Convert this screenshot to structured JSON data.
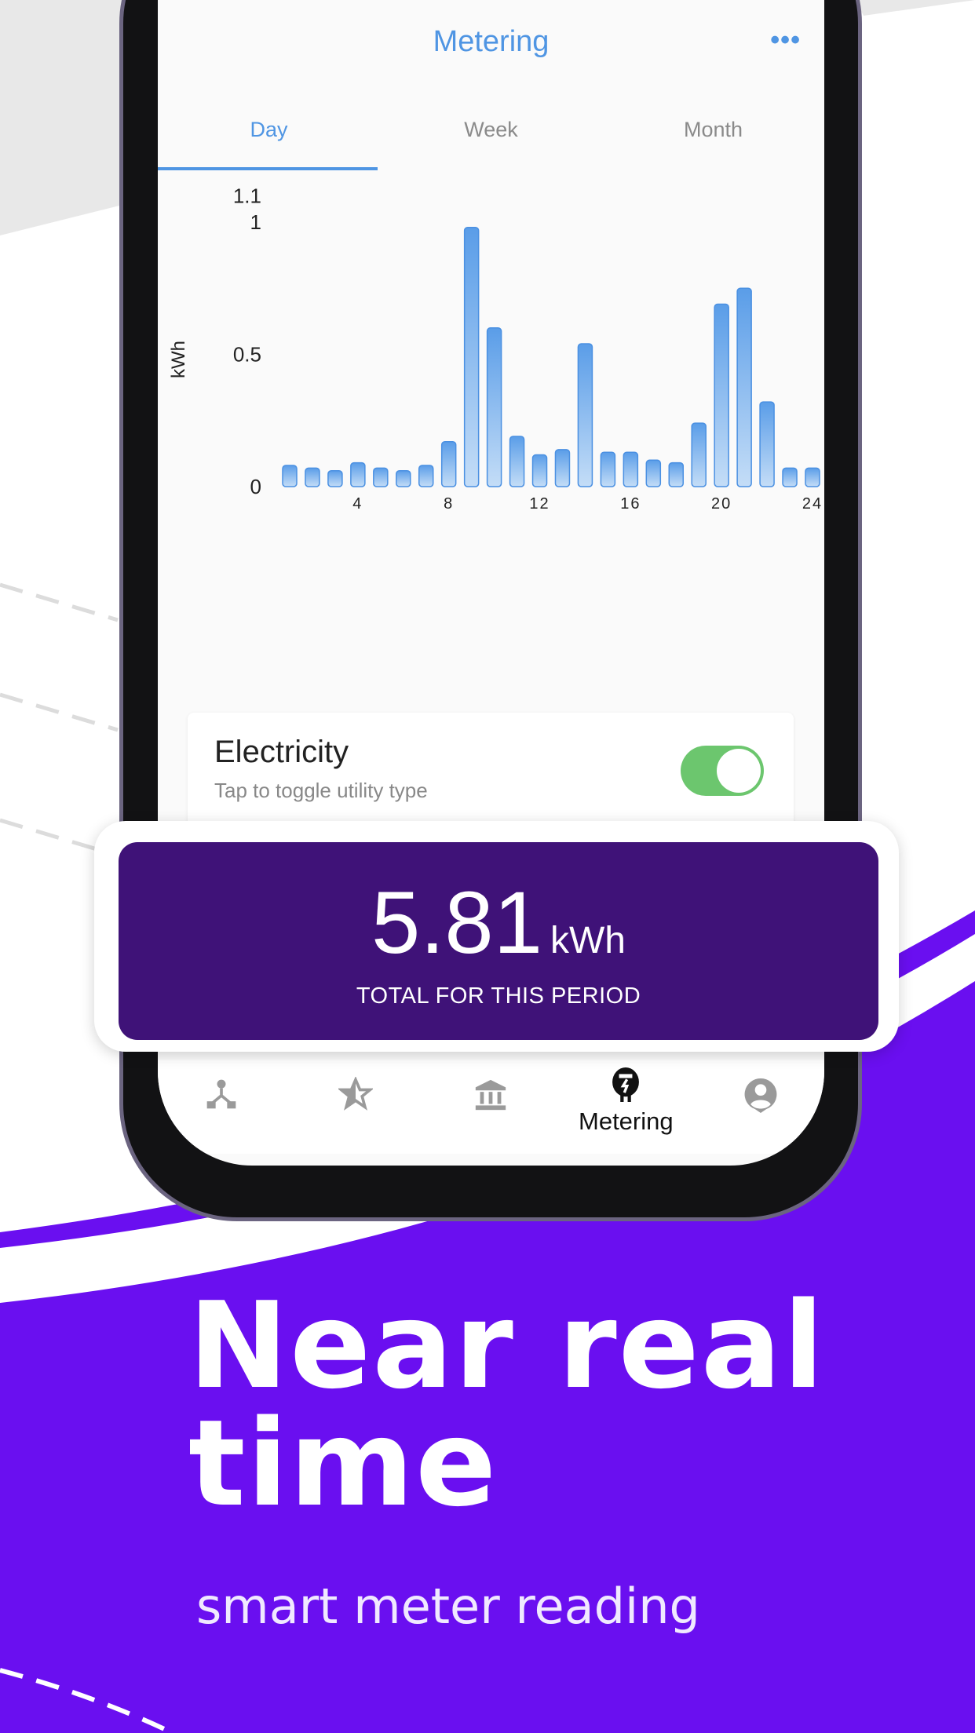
{
  "colors": {
    "accent": "#4f95e3",
    "brand_purple": "#6a0ff0",
    "total_bg": "#3f1278",
    "toggle_on": "#6cc66e"
  },
  "header": {
    "title": "Metering",
    "more_icon": "more-horizontal-icon",
    "more_glyph": "•••"
  },
  "tabs": [
    {
      "label": "Day",
      "active": true
    },
    {
      "label": "Week",
      "active": false
    },
    {
      "label": "Month",
      "active": false
    }
  ],
  "chart_data": {
    "type": "bar",
    "ylabel": "kWh",
    "xlabel": "",
    "ylim": [
      0,
      1.1
    ],
    "yticks": [
      "0",
      "0.5",
      "1",
      "1.1"
    ],
    "ytick_values": [
      0,
      0.5,
      1,
      1.1
    ],
    "x": [
      1,
      2,
      3,
      4,
      5,
      6,
      7,
      8,
      9,
      10,
      11,
      12,
      13,
      14,
      15,
      16,
      17,
      18,
      19,
      20,
      21,
      22,
      23,
      24
    ],
    "xticks": [
      "4",
      "8",
      "12",
      "16",
      "20",
      "24"
    ],
    "values": [
      0.08,
      0.07,
      0.06,
      0.09,
      0.07,
      0.06,
      0.08,
      0.17,
      0.98,
      0.6,
      0.19,
      0.12,
      0.14,
      0.54,
      0.13,
      0.13,
      0.1,
      0.09,
      0.24,
      0.69,
      0.75,
      0.32,
      0.07,
      0.07
    ],
    "grid": false
  },
  "utility": {
    "title": "Electricity",
    "subtitle": "Tap to toggle utility type",
    "toggle_on": true
  },
  "total": {
    "value": "5.81",
    "unit": "kWh",
    "label": "TOTAL FOR THIS PERIOD"
  },
  "nav": [
    {
      "icon": "hierarchy-icon",
      "label": ""
    },
    {
      "icon": "star-half-icon",
      "label": ""
    },
    {
      "icon": "bank-icon",
      "label": ""
    },
    {
      "icon": "meter-icon",
      "label": "Metering",
      "active": true
    },
    {
      "icon": "profile-icon",
      "label": ""
    }
  ],
  "promo": {
    "headline_line1": "Near real",
    "headline_line2": "time",
    "subheadline": "smart meter reading"
  }
}
